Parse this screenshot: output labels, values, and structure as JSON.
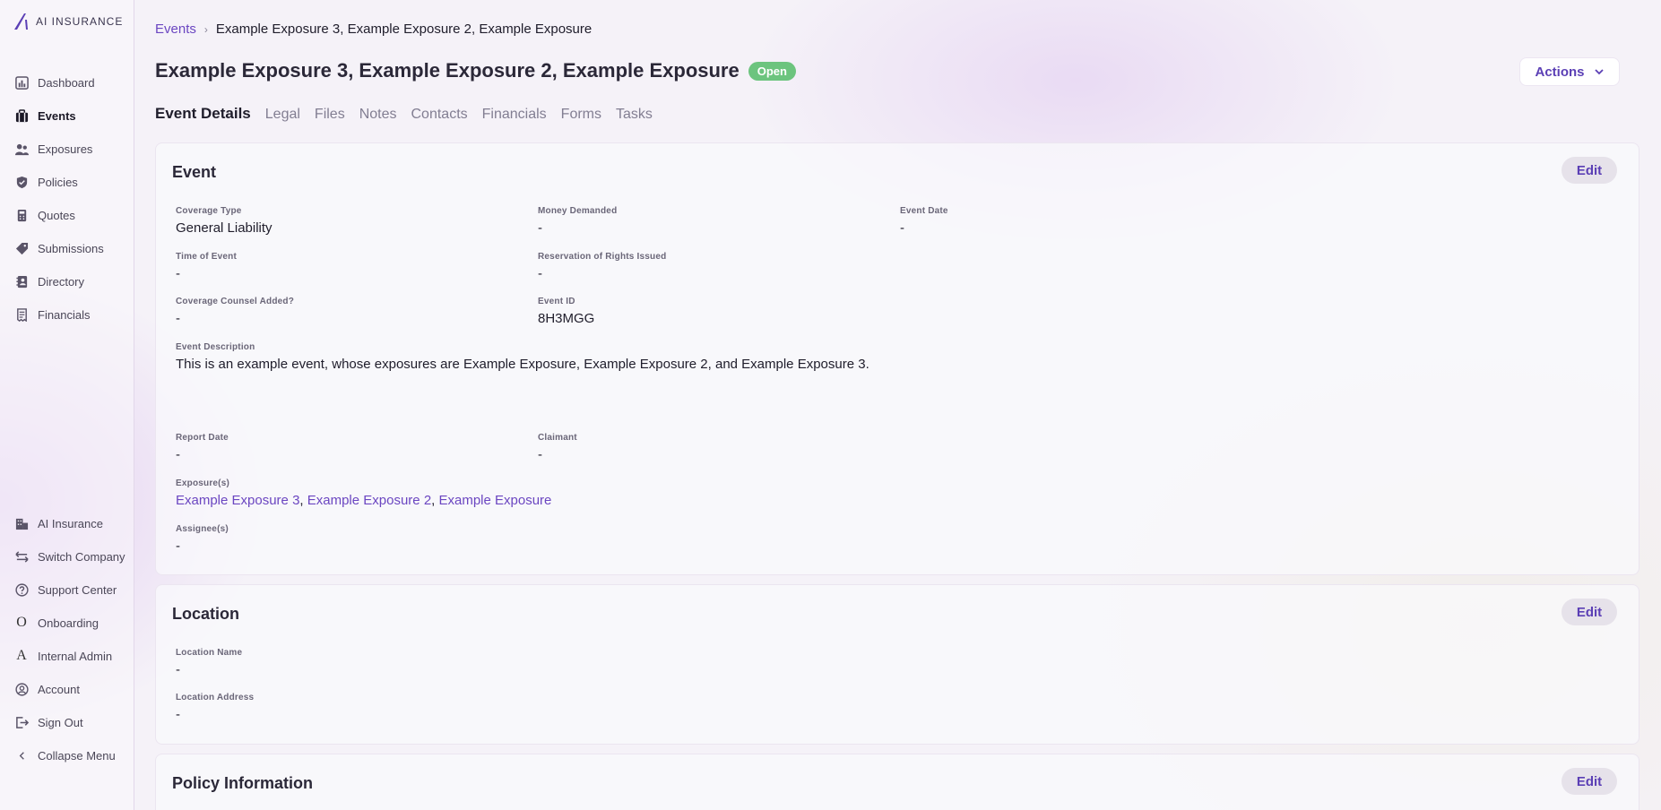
{
  "brand": {
    "name": "AI INSURANCE",
    "accent": "#6b46c1"
  },
  "sidebar": {
    "top_items": [
      {
        "label": "Dashboard",
        "icon": "chart-icon"
      },
      {
        "label": "Events",
        "icon": "briefcase-icon"
      },
      {
        "label": "Exposures",
        "icon": "users-icon"
      },
      {
        "label": "Policies",
        "icon": "shield-icon"
      },
      {
        "label": "Quotes",
        "icon": "calculator-icon"
      },
      {
        "label": "Submissions",
        "icon": "tag-icon"
      },
      {
        "label": "Directory",
        "icon": "address-book-icon"
      },
      {
        "label": "Financials",
        "icon": "receipt-icon"
      }
    ],
    "bottom_items": [
      {
        "label": "AI Insurance",
        "icon": "building-icon"
      },
      {
        "label": "Switch Company",
        "icon": "swap-icon"
      },
      {
        "label": "Support Center",
        "icon": "help-icon"
      },
      {
        "label": "Onboarding",
        "icon": "O"
      },
      {
        "label": "Internal Admin",
        "icon": "A"
      },
      {
        "label": "Account",
        "icon": "account-icon"
      },
      {
        "label": "Sign Out",
        "icon": "sign-out-icon"
      },
      {
        "label": "Collapse Menu",
        "icon": "chevron-left-icon"
      }
    ]
  },
  "breadcrumb": {
    "root": "Events",
    "current": "Example Exposure 3, Example Exposure 2, Example Exposure"
  },
  "header": {
    "title": "Example Exposure 3, Example Exposure 2, Example Exposure",
    "status": "Open",
    "actions_label": "Actions"
  },
  "tabs": [
    "Event Details",
    "Legal",
    "Files",
    "Notes",
    "Contacts",
    "Financials",
    "Forms",
    "Tasks"
  ],
  "event_card": {
    "title": "Event",
    "edit_label": "Edit",
    "coverage_type": {
      "label": "Coverage Type",
      "value": "General Liability"
    },
    "money_demanded": {
      "label": "Money Demanded",
      "value": "-"
    },
    "event_date": {
      "label": "Event Date",
      "value": "-"
    },
    "time_of_event": {
      "label": "Time of Event",
      "value": "-"
    },
    "reservation": {
      "label": "Reservation of Rights Issued",
      "value": "-"
    },
    "coverage_counsel": {
      "label": "Coverage Counsel Added?",
      "value": "-"
    },
    "event_id": {
      "label": "Event ID",
      "value": "8H3MGG"
    },
    "description": {
      "label": "Event Description",
      "value": "This is an example event, whose exposures are Example Exposure, Example Exposure 2, and Example Exposure 3."
    },
    "report_date": {
      "label": "Report Date",
      "value": "-"
    },
    "claimant": {
      "label": "Claimant",
      "value": "-"
    },
    "exposures": {
      "label": "Exposure(s)",
      "items": [
        "Example Exposure 3",
        "Example Exposure 2",
        "Example Exposure"
      ],
      "sep": ","
    },
    "assignees": {
      "label": "Assignee(s)",
      "value": "-"
    }
  },
  "location_card": {
    "title": "Location",
    "edit_label": "Edit",
    "location_name": {
      "label": "Location Name",
      "value": "-"
    },
    "location_address": {
      "label": "Location Address",
      "value": "-"
    }
  },
  "policy_card": {
    "title": "Policy Information",
    "edit_label": "Edit"
  }
}
